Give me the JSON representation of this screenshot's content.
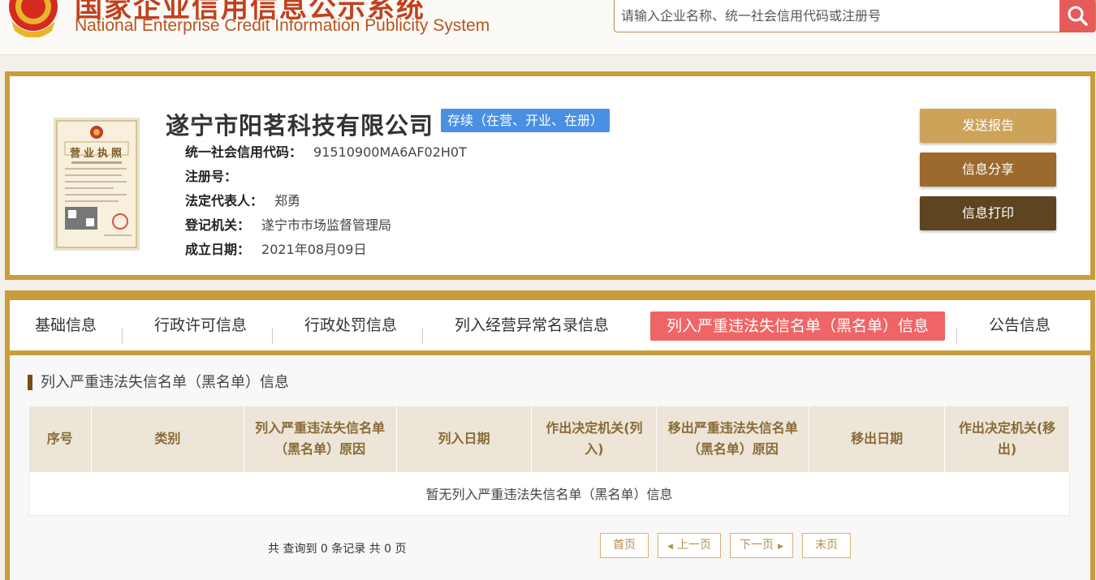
{
  "header": {
    "title_cn": "国家企业信用信息公示系统",
    "title_en": "National Enterprise Credit Information Publicity System",
    "search_placeholder": "请输入企业名称、统一社会信用代码或注册号"
  },
  "company": {
    "name": "遂宁市阳茗科技有限公司",
    "status": "存续（在营、开业、在册）",
    "fields": [
      {
        "label": "统一社会信用代码：",
        "value": "91510900MA6AF02H0T"
      },
      {
        "label": "注册号：",
        "value": ""
      },
      {
        "label": "法定代表人：",
        "value": "郑勇"
      },
      {
        "label": "登记机关：",
        "value": "遂宁市市场监督管理局"
      },
      {
        "label": "成立日期：",
        "value": "2021年08月09日"
      }
    ],
    "license_title": "营业执照",
    "actions": {
      "send_report": "发送报告",
      "share": "信息分享",
      "print": "信息打印"
    }
  },
  "tabs": [
    {
      "label": "基础信息"
    },
    {
      "label": "行政许可信息"
    },
    {
      "label": "行政处罚信息"
    },
    {
      "label": "列入经营异常名录信息"
    },
    {
      "label": "列入严重违法失信名单（黑名单）信息",
      "active": true
    },
    {
      "label": "公告信息"
    }
  ],
  "section": {
    "title": "列入严重违法失信名单（黑名单）信息",
    "columns": [
      "序号",
      "类别",
      "列入严重违法失信名单（黑名单）原因",
      "列入日期",
      "作出决定机关(列入)",
      "移出严重违法失信名单（黑名单）原因",
      "移出日期",
      "作出决定机关(移出)"
    ],
    "empty_message": "暂无列入严重违法失信名单（黑名单）信息"
  },
  "pagination": {
    "summary": "共 查询到 0 条记录 共 0 页",
    "first": "首页",
    "prev": "上一页",
    "next": "下一页",
    "last": "末页"
  },
  "colors": {
    "gold_border": "#c99d3c",
    "active_tab": "#ef6565",
    "status_badge": "#4a90e2",
    "btn_send": "#cda35a",
    "btn_share": "#9c6a2d",
    "btn_print": "#5e4420",
    "search_button": "#e75a5a"
  }
}
